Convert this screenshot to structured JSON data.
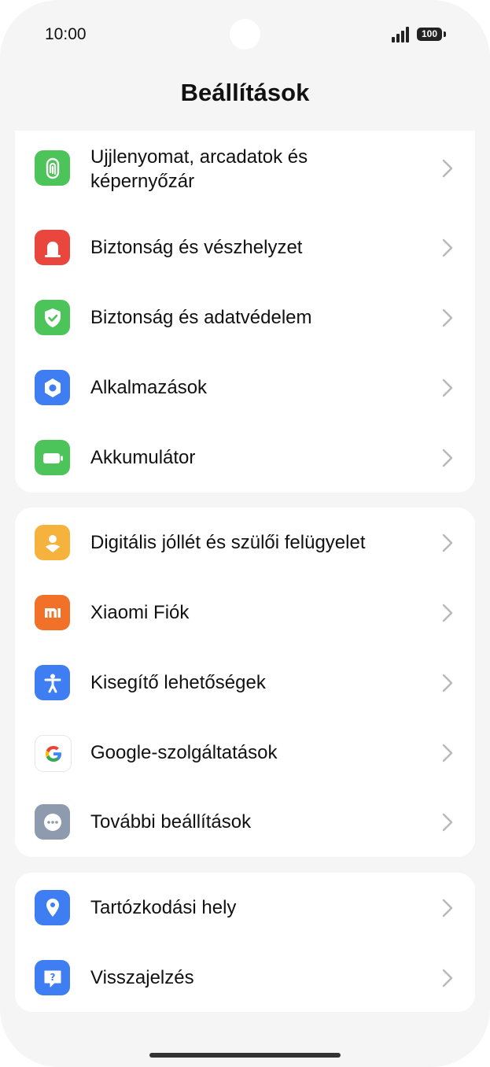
{
  "status_bar": {
    "time": "10:00",
    "battery": "100"
  },
  "page": {
    "title": "Beállítások"
  },
  "groups": [
    {
      "items": [
        {
          "label": "Ujjlenyomat, arcadatok és képernyőzár",
          "icon": "fingerprint-icon",
          "color": "#4cc45a"
        },
        {
          "label": "Biztonság és vészhelyzet",
          "icon": "emergency-alarm-icon",
          "color": "#e9473e"
        },
        {
          "label": "Biztonság és adatvédelem",
          "icon": "shield-check-icon",
          "color": "#4cc45a"
        },
        {
          "label": "Alkalmazások",
          "icon": "apps-hexagon-icon",
          "color": "#3f7ef2"
        },
        {
          "label": "Akkumulátor",
          "icon": "battery-icon",
          "color": "#4cc45a"
        }
      ]
    },
    {
      "items": [
        {
          "label": "Digitális jóllét és szülői felügyelet",
          "icon": "wellbeing-person-icon",
          "color": "#f5b23d"
        },
        {
          "label": "Xiaomi Fiók",
          "icon": "xiaomi-logo-icon",
          "color": "#f07127"
        },
        {
          "label": "Kisegítő lehetőségek",
          "icon": "accessibility-icon",
          "color": "#3f7ef2"
        },
        {
          "label": "Google-szolgáltatások",
          "icon": "google-logo-icon",
          "color": "#ffffff"
        },
        {
          "label": "További beállítások",
          "icon": "more-dots-icon",
          "color": "#8e9aae"
        }
      ]
    },
    {
      "items": [
        {
          "label": "Tartózkodási hely",
          "icon": "location-pin-icon",
          "color": "#3f7ef2"
        },
        {
          "label": "Visszajelzés",
          "icon": "feedback-question-icon",
          "color": "#3f7ef2"
        }
      ]
    }
  ]
}
